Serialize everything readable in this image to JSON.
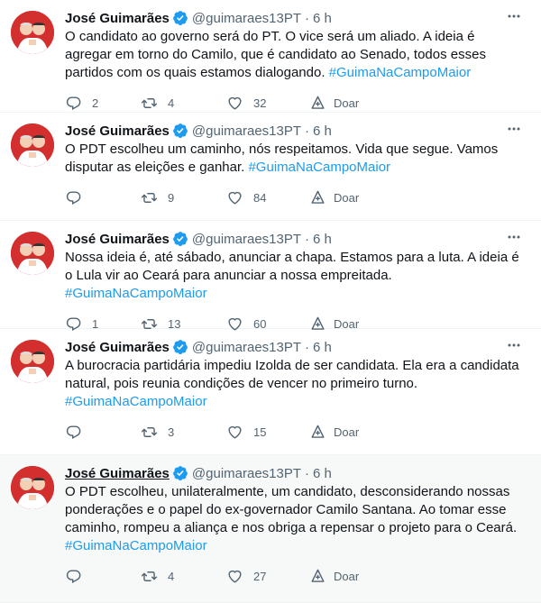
{
  "author": {
    "name": "José Guimarães",
    "handle": "@guimaraes13PT",
    "separator": "·"
  },
  "colors": {
    "text": "#0f1419",
    "secondary": "#536471",
    "accent": "#1d9bf0",
    "avatar_bg": "#d32f2f"
  },
  "icons": {
    "verified": "verified-badge-icon",
    "more": "more-options-icon",
    "reply": "reply-icon",
    "retweet": "retweet-icon",
    "like": "heart-icon",
    "share": "share-icon"
  },
  "share_label": "Doar",
  "tweets": [
    {
      "time": "6 h",
      "text": "O candidato ao governo será do PT. O vice será um aliado. A ideia é agregar em torno do Camilo, que é candidato ao Senado, todos esses partidos com os quais estamos dialogando. ",
      "hashtag": "#GuimaNaCampoMaior",
      "replies": "2",
      "retweets": "4",
      "likes": "32"
    },
    {
      "time": "6 h",
      "text": "O PDT escolheu um caminho, nós respeitamos. Vida que segue. Vamos disputar as eleições e ganhar. ",
      "hashtag": "#GuimaNaCampoMaior",
      "replies": "",
      "retweets": "9",
      "likes": "84"
    },
    {
      "time": "6 h",
      "text": "Nossa ideia é, até sábado, anunciar a chapa. Estamos para a luta. A ideia é o Lula vir ao Ceará para anunciar a nossa empreitada. ",
      "hashtag": "#GuimaNaCampoMaior",
      "replies": "1",
      "retweets": "13",
      "likes": "60"
    },
    {
      "time": "6 h",
      "text": "A burocracia partidária impediu Izolda de ser candidata. Ela era a candidata natural, pois reunia condições de vencer no primeiro turno. ",
      "hashtag": "#GuimaNaCampoMaior",
      "replies": "",
      "retweets": "3",
      "likes": "15"
    },
    {
      "time": "6 h",
      "text": "O PDT escolheu, unilateralmente, um candidato, desconsiderando nossas ponderações e o papel do ex-governador Camilo Santana. Ao tomar esse caminho, rompeu a aliança e nos obriga a repensar o projeto para o Ceará. ",
      "hashtag": "#GuimaNaCampoMaior",
      "replies": "",
      "retweets": "4",
      "likes": "27"
    }
  ]
}
